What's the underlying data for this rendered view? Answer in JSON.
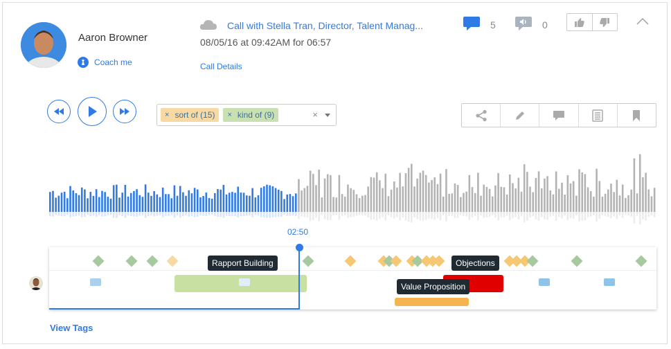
{
  "user": {
    "name": "Aaron Browner",
    "coach_label": "Coach me"
  },
  "call": {
    "title": "Call with Stella Tran, Director, Talent Manag...",
    "meta": "08/05/16 at 09:42AM for 06:57",
    "details_label": "Call Details"
  },
  "stats": {
    "comments": "5",
    "audio_comments": "0"
  },
  "tags": [
    {
      "label": "sort of (15)",
      "color": "#f9d9a3"
    },
    {
      "label": "kind of (9)",
      "color": "#c9e0b3"
    }
  ],
  "tag_clear": "×",
  "chip_x": "×",
  "player": {
    "current_time": "02:50",
    "progress": 0.41
  },
  "timeline": {
    "tooltips": [
      "Rapport Building",
      "Objections",
      "Value Proposition"
    ]
  },
  "footer": {
    "view_tags_label": "View Tags"
  },
  "colors": {
    "accent": "#2f7ae5",
    "played": "#2f7ae5",
    "unplayed": "#b3b3b3",
    "rapport": "#c9e0a3",
    "objections": "#e00000",
    "value": "#f6b450",
    "diamond_green": "#a6c9a0",
    "diamond_orange": "#f7c874"
  }
}
